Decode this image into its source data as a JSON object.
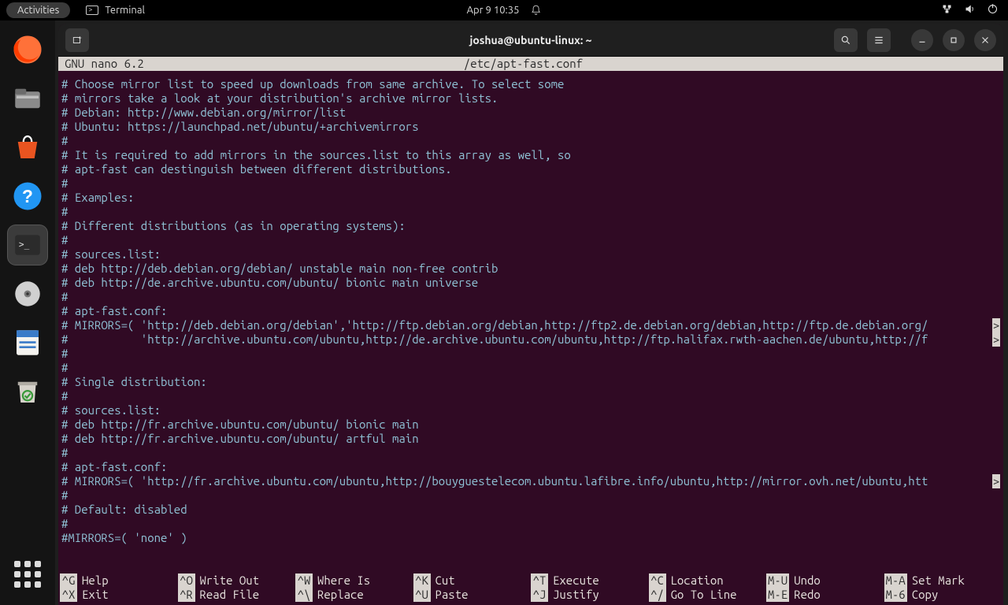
{
  "panel": {
    "activities": "Activities",
    "app_label": "Terminal",
    "clock": "Apr 9  10:35"
  },
  "window": {
    "title": "joshua@ubuntu-linux: ~"
  },
  "nano": {
    "app": "  GNU nano 6.2",
    "file": "/etc/apt-fast.conf",
    "lines": [
      "# Choose mirror list to speed up downloads from same archive. To select some",
      "# mirrors take a look at your distribution's archive mirror lists.",
      "# Debian: http://www.debian.org/mirror/list",
      "# Ubuntu: https://launchpad.net/ubuntu/+archivemirrors",
      "#",
      "# It is required to add mirrors in the sources.list to this array as well, so",
      "# apt-fast can destinguish between different distributions.",
      "#",
      "# Examples:",
      "#",
      "# Different distributions (as in operating systems):",
      "#",
      "# sources.list:",
      "# deb http://deb.debian.org/debian/ unstable main non-free contrib",
      "# deb http://de.archive.ubuntu.com/ubuntu/ bionic main universe",
      "#",
      "# apt-fast.conf:",
      "# MIRRORS=( 'http://deb.debian.org/debian','http://ftp.debian.org/debian,http://ftp2.de.debian.org/debian,http://ftp.de.debian.org/",
      "#           'http://archive.ubuntu.com/ubuntu,http://de.archive.ubuntu.com/ubuntu,http://ftp.halifax.rwth-aachen.de/ubuntu,http://f",
      "#",
      "#",
      "# Single distribution:",
      "#",
      "# sources.list:",
      "# deb http://fr.archive.ubuntu.com/ubuntu/ bionic main",
      "# deb http://fr.archive.ubuntu.com/ubuntu/ artful main",
      "#",
      "# apt-fast.conf:",
      "# MIRRORS=( 'http://fr.archive.ubuntu.com/ubuntu,http://bouyguestelecom.ubuntu.lafibre.info/ubuntu,http://mirror.ovh.net/ubuntu,htt",
      "#",
      "# Default: disabled",
      "#",
      "#MIRRORS=( 'none' )"
    ],
    "overflow_lines": [
      17,
      18,
      28
    ],
    "shortcuts": {
      "row1": [
        {
          "k": "^G",
          "l": "Help"
        },
        {
          "k": "^O",
          "l": "Write Out"
        },
        {
          "k": "^W",
          "l": "Where Is"
        },
        {
          "k": "^K",
          "l": "Cut"
        },
        {
          "k": "^T",
          "l": "Execute"
        },
        {
          "k": "^C",
          "l": "Location"
        },
        {
          "k": "M-U",
          "l": "Undo"
        },
        {
          "k": "M-A",
          "l": "Set Mark"
        }
      ],
      "row2": [
        {
          "k": "^X",
          "l": "Exit"
        },
        {
          "k": "^R",
          "l": "Read File"
        },
        {
          "k": "^\\",
          "l": "Replace"
        },
        {
          "k": "^U",
          "l": "Paste"
        },
        {
          "k": "^J",
          "l": "Justify"
        },
        {
          "k": "^/",
          "l": "Go To Line"
        },
        {
          "k": "M-E",
          "l": "Redo"
        },
        {
          "k": "M-6",
          "l": "Copy"
        }
      ]
    }
  }
}
